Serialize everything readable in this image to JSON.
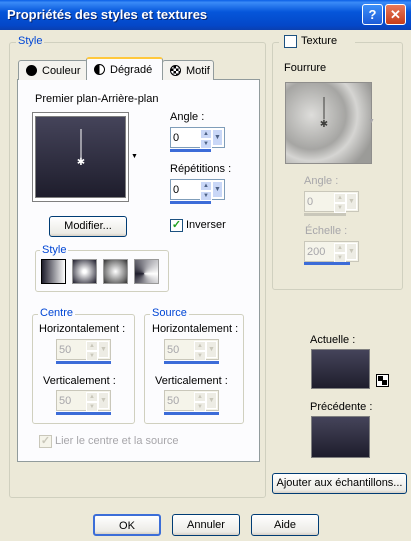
{
  "window": {
    "title": "Propriétés des styles et textures",
    "help_btn": "?",
    "close_btn": "✕"
  },
  "style_group": {
    "label": "Style",
    "tabs": [
      {
        "label": "Couleur",
        "icon": "filled-circle-icon"
      },
      {
        "label": "Dégradé",
        "icon": "half-circle-icon"
      },
      {
        "label": "Motif",
        "icon": "pattern-icon"
      }
    ],
    "gradient_label": "Premier plan-Arrière-plan",
    "angle_label": "Angle :",
    "angle_value": "0",
    "repetitions_label": "Répétitions :",
    "repetitions_value": "0",
    "modify_button": "Modifier...",
    "invert_label": "Inverser",
    "invert_checked": true,
    "style_sub_label": "Style",
    "centre": {
      "label": "Centre",
      "horizontal_label": "Horizontalement :",
      "horizontal_value": "50",
      "vertical_label": "Verticalement :",
      "vertical_value": "50"
    },
    "source": {
      "label": "Source",
      "horizontal_label": "Horizontalement :",
      "horizontal_value": "50",
      "vertical_label": "Verticalement :",
      "vertical_value": "50"
    },
    "link_label": "Lier le centre et la source",
    "link_checked": true
  },
  "texture": {
    "label": "Texture",
    "checked": false,
    "name": "Fourrure",
    "angle_label": "Angle :",
    "angle_value": "0",
    "scale_label": "Échelle :",
    "scale_value": "200"
  },
  "current_label": "Actuelle :",
  "previous_label": "Précédente :",
  "add_samples_button": "Ajouter aux échantillons...",
  "footer": {
    "ok": "OK",
    "cancel": "Annuler",
    "help": "Aide"
  },
  "colors": {
    "titlebar": "#0554E1",
    "dialog_bg": "#ECE9D8",
    "group_label": "#0046D5",
    "gradient_dark": "#1E1D2C",
    "gradient_light": "#45445A"
  }
}
